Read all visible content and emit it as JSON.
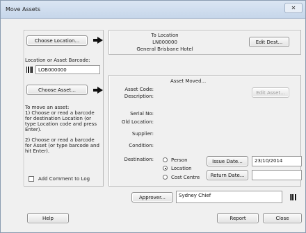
{
  "window": {
    "title": "Move Assets",
    "close_glyph": "✕"
  },
  "left": {
    "choose_location_label": "Choose Location...",
    "location_barcode_label": "Location or Asset Barcode:",
    "location_barcode_value": "LOB000000",
    "choose_asset_label": "Choose Asset...",
    "instructions_title": "To move an asset:",
    "instruction_1": "1) Choose or read a barcode for destination Location (or type Location code and press Enter).",
    "instruction_2": "2) Choose or read a barcode for Asset (or type barcode and hit Enter).",
    "add_comment_label": "Add Comment to Log"
  },
  "destination": {
    "heading": "To Location",
    "code": "LN000000",
    "name": "General Brisbane Hotel",
    "edit_dest_label": "Edit Dest..."
  },
  "asset": {
    "heading": "Asset Moved...",
    "edit_asset_label": "Edit Asset...",
    "asset_code_label": "Asset Code:",
    "description_label": "Description:",
    "serial_label": "Serial No:",
    "old_location_label": "Old Location:",
    "supplier_label": "Supplier:",
    "condition_label": "Condition:",
    "destination_label": "Destination:",
    "dest_options": [
      "Person",
      "Location",
      "Cost Centre"
    ],
    "dest_selected": "Location",
    "issue_date_label": "Issue Date...",
    "issue_date_value": "23/10/2014",
    "return_date_label": "Return Date...",
    "return_date_value": ""
  },
  "approver": {
    "label": "Approver...",
    "value": "Sydney Chief"
  },
  "footer": {
    "help_label": "Help",
    "report_label": "Report",
    "close_label": "Close"
  },
  "icons": {
    "barcode": "barcode-icon",
    "arrow": "arrow-right-icon"
  }
}
